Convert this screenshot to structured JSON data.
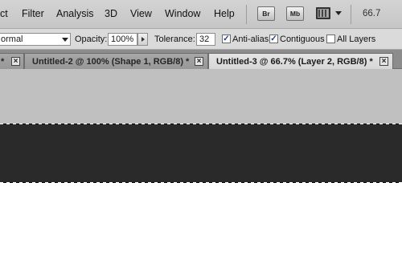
{
  "menubar": {
    "items": [
      {
        "id": "select",
        "label": "ct"
      },
      {
        "id": "filter",
        "label": "Filter"
      },
      {
        "id": "analysis",
        "label": "Analysis"
      },
      {
        "id": "3d",
        "label": "3D"
      },
      {
        "id": "view",
        "label": "View"
      },
      {
        "id": "window",
        "label": "Window"
      },
      {
        "id": "help",
        "label": "Help"
      }
    ],
    "bridge_label": "Br",
    "minibridge_label": "Mb",
    "screen_mode_icon": "screen-mode-icon",
    "zoom_value": "66.7"
  },
  "options": {
    "mode_value": "ormal",
    "opacity_label": "Opacity:",
    "opacity_value": "100%",
    "tolerance_label": "Tolerance:",
    "tolerance_value": "32",
    "antialias_label": "Anti-alias",
    "antialias_checked": true,
    "contiguous_label": "Contiguous",
    "contiguous_checked": true,
    "all_layers_label": "All Layers",
    "all_layers_checked": false
  },
  "tabs": [
    {
      "label": "Untitled-2 @ 100% (Shape 1, RGB/8) *",
      "active": false
    },
    {
      "label": "Untitled-3 @ 66.7% (Layer 2, RGB/8) *",
      "active": true
    }
  ],
  "tab_partial_marker": "*",
  "colors": {
    "menubar_bg": "#c9c9c9",
    "workspace_gray": "#c0c0c0",
    "layer_dark": "#2a2a2a",
    "canvas_white": "#ffffff",
    "checkbox_check": "#1f3f8f"
  }
}
